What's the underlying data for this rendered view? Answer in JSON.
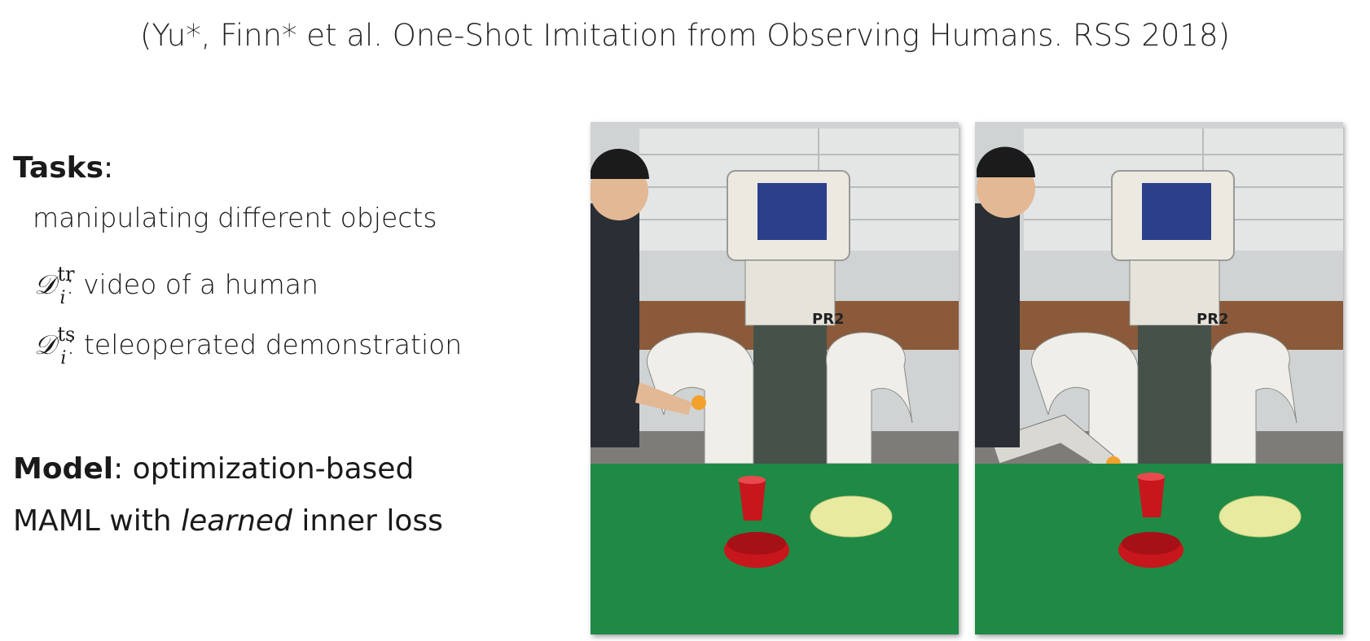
{
  "citation": "(Yu*, Finn* et al. One-Shot Imitation from Observing Humans. RSS 2018)",
  "tasks": {
    "heading": "Tasks",
    "heading_suffix": ":",
    "description": "manipulating different objects",
    "train": {
      "symbol": "𝒟",
      "superscript": "tr",
      "subscript": "i",
      "text": ": video of a human"
    },
    "test": {
      "symbol": "𝒟",
      "superscript": "ts",
      "subscript": "i",
      "text": ": teleoperated demonstration"
    }
  },
  "model": {
    "heading": "Model",
    "line1_rest": ": optimization-based",
    "line2_prefix": "MAML with ",
    "line2_emph": "learned",
    "line2_suffix": " inner loss"
  },
  "photos": [
    {
      "robot_label": "PR2",
      "scene": "human holding orange ball near robot, table with red cup, red bowl and plate"
    },
    {
      "robot_label": "PR2",
      "scene": "robot gripper holding orange ball, table with red cup, red bowl and plate"
    }
  ],
  "colors": {
    "table_green": "#1f8a45",
    "cup_red": "#c8161d",
    "plate_yellow": "#e8eaa0"
  }
}
